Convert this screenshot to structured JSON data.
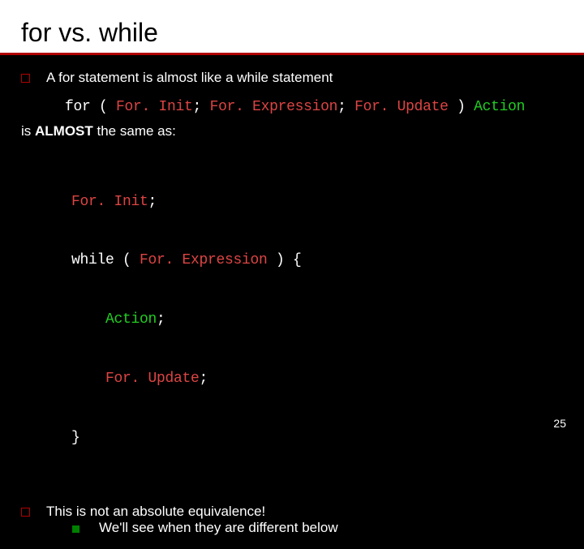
{
  "title": "for vs. while",
  "bullet1": "A for statement is almost like a while statement",
  "code1": {
    "kw": "for ( ",
    "init": "For. Init",
    "semi1": "; ",
    "expr": "For. Expression",
    "semi2": "; ",
    "upd": "For. Update",
    "paren": " ) ",
    "action": "Action"
  },
  "almost_pre": "is ",
  "almost_bold": "ALMOST",
  "almost_post": " the same as:",
  "block": {
    "l1a": "For. Init",
    "l1b": ";",
    "l2a": "while ( ",
    "l2b": "For. Expression",
    "l2c": " ) {",
    "l3a": "    ",
    "l3b": "Action",
    "l3c": ";",
    "l4a": "    ",
    "l4b": "For. Update",
    "l4c": ";",
    "l5": "}"
  },
  "bullet2": "This is not an absolute equivalence!",
  "sub1": "We'll see when they are different below",
  "page": "25"
}
